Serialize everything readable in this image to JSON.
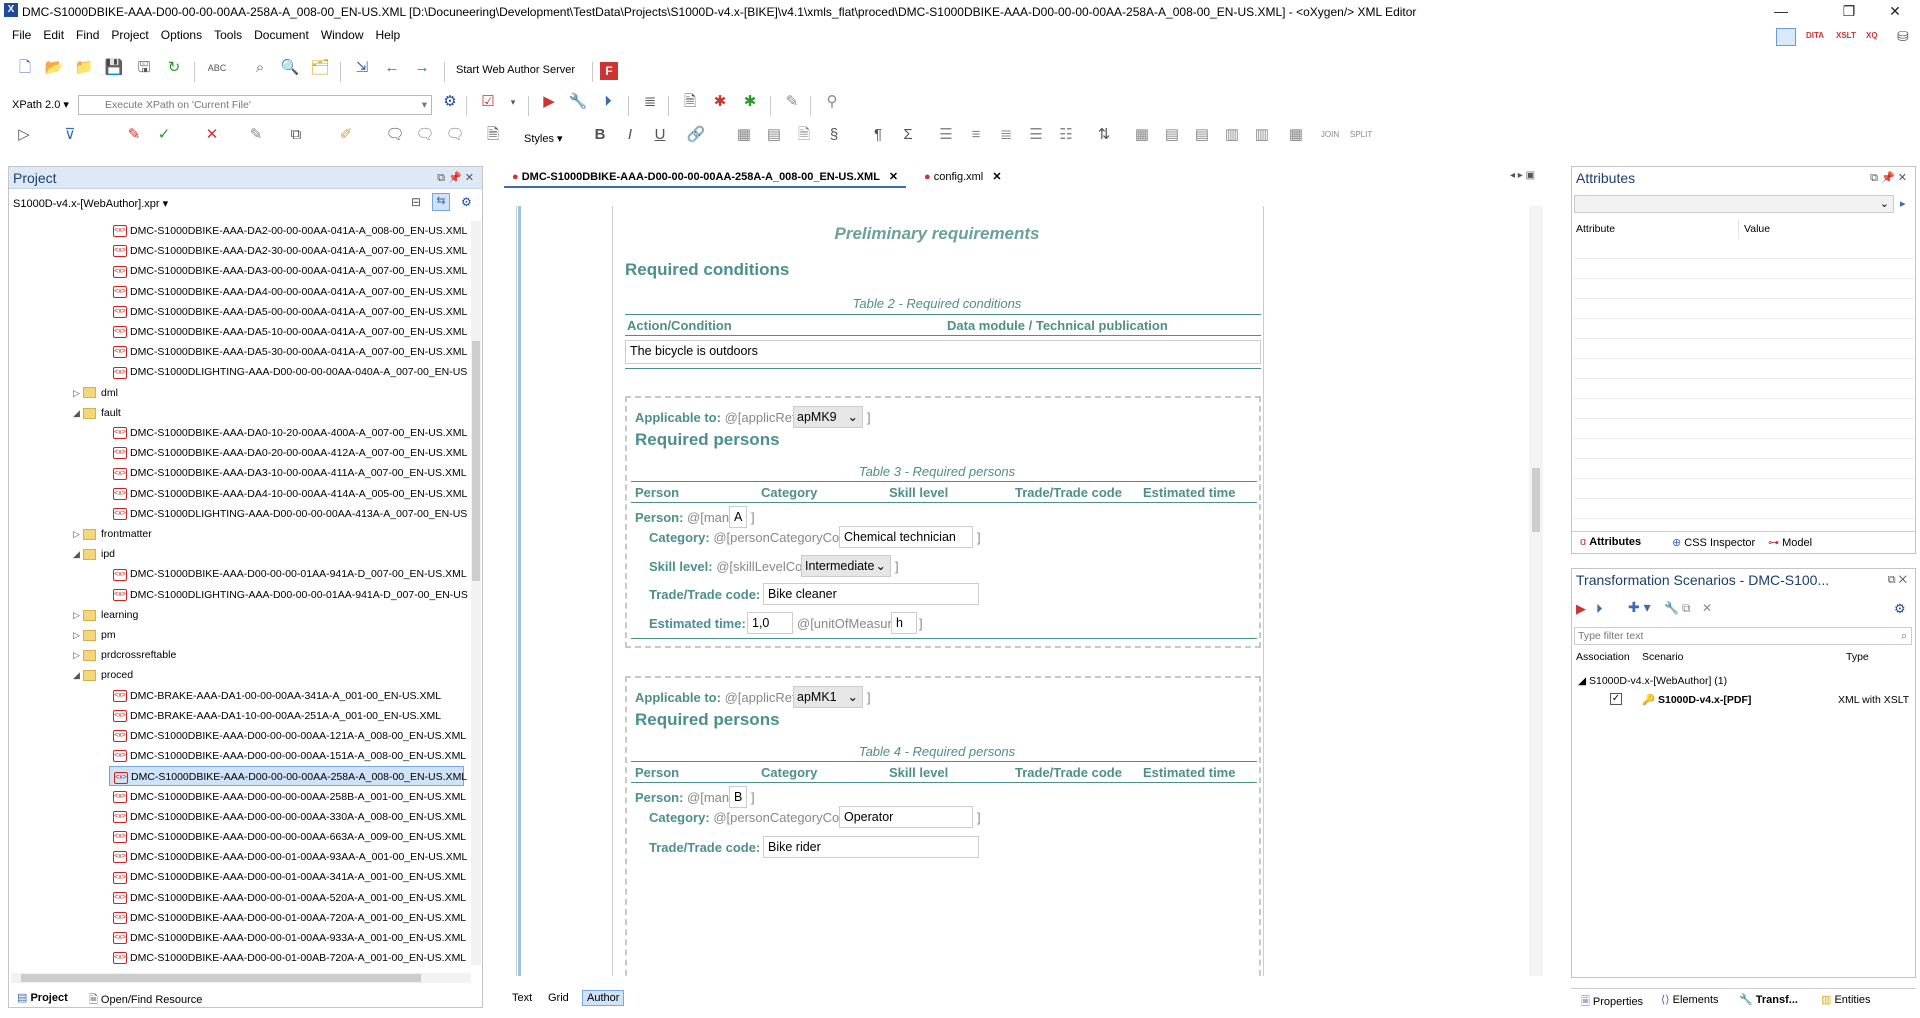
{
  "window": {
    "title": "DMC-S1000DBIKE-AAA-D00-00-00-00AA-258A-A_008-00_EN-US.XML [D:\\Docuneering\\Development\\TestData\\Projects\\S1000D-v4.x-[BIKE]\\v4.1\\xmls_flat\\proced\\DMC-S1000DBIKE-AAA-D00-00-00-00AA-258A-A_008-00_EN-US.XML] - <oXygen/> XML Editor",
    "minimize": "—",
    "restore": "❐",
    "close": "✕"
  },
  "menu": [
    "File",
    "Edit",
    "Find",
    "Project",
    "Options",
    "Tools",
    "Document",
    "Window",
    "Help"
  ],
  "toolbar": {
    "web_author": "Start Web Author Server",
    "xpath_version": "XPath 2.0",
    "xpath_placeholder": "Execute XPath on 'Current File'",
    "styles": "Styles",
    "perspectives": [
      "DITA",
      "XSLT",
      "XQ"
    ]
  },
  "project": {
    "title": "Project",
    "file": "S1000D-v4.x-[WebAuthor].xpr",
    "rows": [
      {
        "type": "file",
        "label": "DMC-S1000DBIKE-AAA-DA2-00-00-00AA-041A-A_008-00_EN-US.XML"
      },
      {
        "type": "file",
        "label": "DMC-S1000DBIKE-AAA-DA2-30-00-00AA-041A-A_007-00_EN-US.XML"
      },
      {
        "type": "file",
        "label": "DMC-S1000DBIKE-AAA-DA3-00-00-00AA-041A-A_007-00_EN-US.XML"
      },
      {
        "type": "file",
        "label": "DMC-S1000DBIKE-AAA-DA4-00-00-00AA-041A-A_007-00_EN-US.XML"
      },
      {
        "type": "file",
        "label": "DMC-S1000DBIKE-AAA-DA5-00-00-00AA-041A-A_007-00_EN-US.XML"
      },
      {
        "type": "file",
        "label": "DMC-S1000DBIKE-AAA-DA5-10-00-00AA-041A-A_007-00_EN-US.XML"
      },
      {
        "type": "file",
        "label": "DMC-S1000DBIKE-AAA-DA5-30-00-00AA-041A-A_007-00_EN-US.XML"
      },
      {
        "type": "file",
        "label": "DMC-S1000DLIGHTING-AAA-D00-00-00-00AA-040A-A_007-00_EN-US"
      },
      {
        "type": "folder",
        "label": "dml",
        "open": false
      },
      {
        "type": "folder",
        "label": "fault",
        "open": true
      },
      {
        "type": "file",
        "label": "DMC-S1000DBIKE-AAA-DA0-10-20-00AA-400A-A_007-00_EN-US.XML"
      },
      {
        "type": "file",
        "label": "DMC-S1000DBIKE-AAA-DA0-20-00-00AA-412A-A_007-00_EN-US.XML"
      },
      {
        "type": "file",
        "label": "DMC-S1000DBIKE-AAA-DA3-10-00-00AA-411A-A_007-00_EN-US.XML"
      },
      {
        "type": "file",
        "label": "DMC-S1000DBIKE-AAA-DA4-10-00-00AA-414A-A_005-00_EN-US.XML"
      },
      {
        "type": "file",
        "label": "DMC-S1000DLIGHTING-AAA-D00-00-00-00AA-413A-A_007-00_EN-US"
      },
      {
        "type": "folder",
        "label": "frontmatter",
        "open": false
      },
      {
        "type": "folder",
        "label": "ipd",
        "open": true
      },
      {
        "type": "file",
        "label": "DMC-S1000DBIKE-AAA-D00-00-00-01AA-941A-D_007-00_EN-US.XML"
      },
      {
        "type": "file",
        "label": "DMC-S1000DLIGHTING-AAA-D00-00-00-01AA-941A-D_007-00_EN-US"
      },
      {
        "type": "folder",
        "label": "learning",
        "open": false
      },
      {
        "type": "folder",
        "label": "pm",
        "open": false
      },
      {
        "type": "folder",
        "label": "prdcrossreftable",
        "open": false
      },
      {
        "type": "folder",
        "label": "proced",
        "open": true
      },
      {
        "type": "file",
        "label": "DMC-BRAKE-AAA-DA1-00-00-00AA-341A-A_001-00_EN-US.XML"
      },
      {
        "type": "file",
        "label": "DMC-BRAKE-AAA-DA1-10-00-00AA-251A-A_001-00_EN-US.XML"
      },
      {
        "type": "file",
        "label": "DMC-S1000DBIKE-AAA-D00-00-00-00AA-121A-A_008-00_EN-US.XML"
      },
      {
        "type": "file",
        "label": "DMC-S1000DBIKE-AAA-D00-00-00-00AA-151A-A_008-00_EN-US.XML"
      },
      {
        "type": "file",
        "label": "DMC-S1000DBIKE-AAA-D00-00-00-00AA-258A-A_008-00_EN-US.XML",
        "selected": true
      },
      {
        "type": "file",
        "label": "DMC-S1000DBIKE-AAA-D00-00-00-00AA-258B-A_001-00_EN-US.XML"
      },
      {
        "type": "file",
        "label": "DMC-S1000DBIKE-AAA-D00-00-00-00AA-330A-A_008-00_EN-US.XML"
      },
      {
        "type": "file",
        "label": "DMC-S1000DBIKE-AAA-D00-00-00-00AA-663A-A_009-00_EN-US.XML"
      },
      {
        "type": "file",
        "label": "DMC-S1000DBIKE-AAA-D00-00-01-00AA-93AA-A_001-00_EN-US.XML"
      },
      {
        "type": "file",
        "label": "DMC-S1000DBIKE-AAA-D00-00-01-00AA-341A-A_001-00_EN-US.XML"
      },
      {
        "type": "file",
        "label": "DMC-S1000DBIKE-AAA-D00-00-01-00AA-520A-A_001-00_EN-US.XML"
      },
      {
        "type": "file",
        "label": "DMC-S1000DBIKE-AAA-D00-00-01-00AA-720A-A_001-00_EN-US.XML"
      },
      {
        "type": "file",
        "label": "DMC-S1000DBIKE-AAA-D00-00-01-00AA-933A-A_001-00_EN-US.XML"
      },
      {
        "type": "file",
        "label": "DMC-S1000DBIKE-AAA-D00-00-01-00AB-720A-A_001-00_EN-US.XML"
      }
    ],
    "bottom_tabs": [
      "Project",
      "Open/Find Resource"
    ]
  },
  "editor": {
    "tabs": [
      "DMC-S1000DBIKE-AAA-D00-00-00-00AA-258A-A_008-00_EN-US.XML",
      "config.xml"
    ],
    "heading": "Preliminary requirements",
    "req_conditions": "Required conditions",
    "table2_caption": "Table 2 - Required conditions",
    "table2_cols": [
      "Action/Condition",
      "Data module / Technical publication"
    ],
    "table2_row": "The bicycle is outdoors",
    "block1": {
      "applic": "Applicable to: @[applicRefId",
      "applic_val": "apMK9",
      "title": "Required persons",
      "caption": "Table 3 - Required persons",
      "cols": [
        "Person",
        "Category",
        "Skill level",
        "Trade/Trade code",
        "Estimated time"
      ],
      "person_lbl": "Person:",
      "man": "@[man",
      "man_val": "A",
      "cat_lbl": "Category:",
      "cat_attr": "@[personCategoryCode",
      "cat_val": "Chemical technician",
      "skill_lbl": "Skill level:",
      "skill_attr": "@[skillLevelCode",
      "skill_val": "Intermediate",
      "trade_lbl": "Trade/Trade code:",
      "trade_val": "Bike cleaner",
      "time_lbl": "Estimated time:",
      "time_val": "1,0",
      "uom_attr": "@[unitOfMeasure",
      "uom_val": "h"
    },
    "block2": {
      "applic": "Applicable to: @[applicRefId",
      "applic_val": "apMK1",
      "title": "Required persons",
      "caption": "Table 4 - Required persons",
      "cols": [
        "Person",
        "Category",
        "Skill level",
        "Trade/Trade code",
        "Estimated time"
      ],
      "person_lbl": "Person:",
      "man": "@[man",
      "man_val": "B",
      "cat_lbl": "Category:",
      "cat_attr": "@[personCategoryCode",
      "cat_val": "Operator",
      "trade_lbl": "Trade/Trade code:",
      "trade_val": "Bike rider"
    },
    "modes": [
      "Text",
      "Grid",
      "Author"
    ]
  },
  "attributes": {
    "title": "Attributes",
    "cols": [
      "Attribute",
      "Value"
    ],
    "tabs": [
      "Attributes",
      "CSS Inspector",
      "Model"
    ]
  },
  "transform": {
    "title": "Transformation Scenarios - DMC-S100...",
    "filter_placeholder": "Type filter text",
    "cols": [
      "Association",
      "Scenario",
      "Type"
    ],
    "group": "S1000D-v4.x-[WebAuthor] (1)",
    "scenario": "S1000D-v4.x-[PDF]",
    "type": "XML with XSLT"
  },
  "status_tabs": [
    "Properties",
    "Elements",
    "Transf...",
    "Entities"
  ]
}
